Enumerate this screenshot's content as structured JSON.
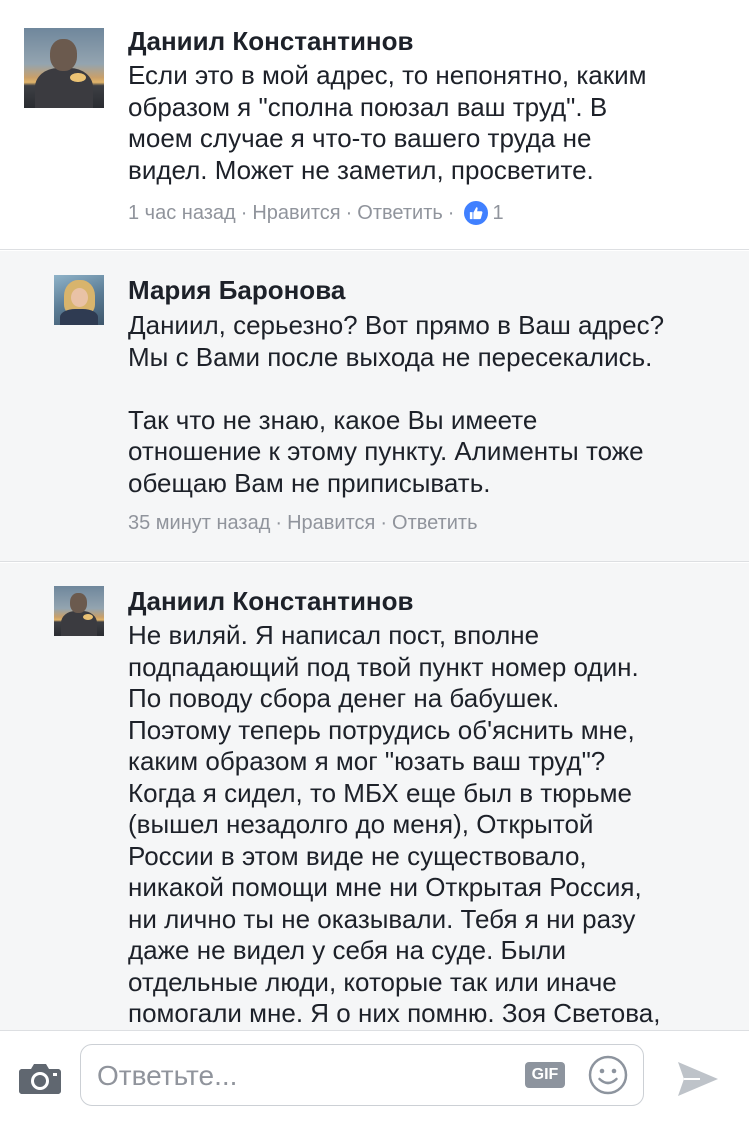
{
  "comments": [
    {
      "author": "Даниил Константинов",
      "lines": [
        "Если это в мой адрес, то непонятно, каким",
        "образом я \"сполна поюзал ваш труд\". В",
        "моем случае я что-то вашего труда не",
        "видел. Может не заметил, просветите."
      ],
      "time": "1 час назад",
      "like_label": "Нравится",
      "reply_label": "Ответить",
      "likes": "1"
    },
    {
      "author": "Мария Баронова",
      "paragraphs": [
        [
          "Даниил, серьезно? Вот прямо в Ваш адрес?",
          "Мы с Вами после выхода не пересекались."
        ],
        [
          "Так что не знаю, какое Вы имеете",
          "отношение к этому  пункту. Алименты тоже",
          "обещаю Вам не приписывать."
        ]
      ],
      "time": "35 минут назад",
      "like_label": "Нравится",
      "reply_label": "Ответить"
    },
    {
      "author": "Даниил Константинов",
      "lines": [
        "Не виляй. Я написал пост, вполне",
        "подпадающий под твой пункт номер один.",
        "По поводу сбора денег на бабушек.",
        "Поэтому теперь потрудись об'яснить мне,",
        "каким образом я мог \"юзать ваш труд\"?",
        "Когда я сидел, то МБХ еще был в тюрьме",
        "(вышел незадолго до меня), Открытой",
        "России в этом виде не существовало,",
        "никакой помощи мне ни Открытая Россия,",
        "ни лично ты не оказывали. Тебя я ни разу",
        "даже не видел у себя на суде. Были",
        "отдельные люди, которые так или иначе",
        "помогали мне. Я о них помню. Зоя Светова,"
      ]
    }
  ],
  "composer": {
    "placeholder": "Ответьте...",
    "gif_label": "GIF"
  },
  "icons": {
    "camera": "camera-icon",
    "gif": "gif-icon",
    "emoji": "smiley-icon",
    "send": "send-icon",
    "like": "thumbs-up-icon"
  },
  "colors": {
    "text": "#1d2129",
    "meta": "#90949c",
    "like_blue": "#4080ff",
    "reply_bg": "#f5f6f7",
    "divider": "#dddfe2"
  }
}
